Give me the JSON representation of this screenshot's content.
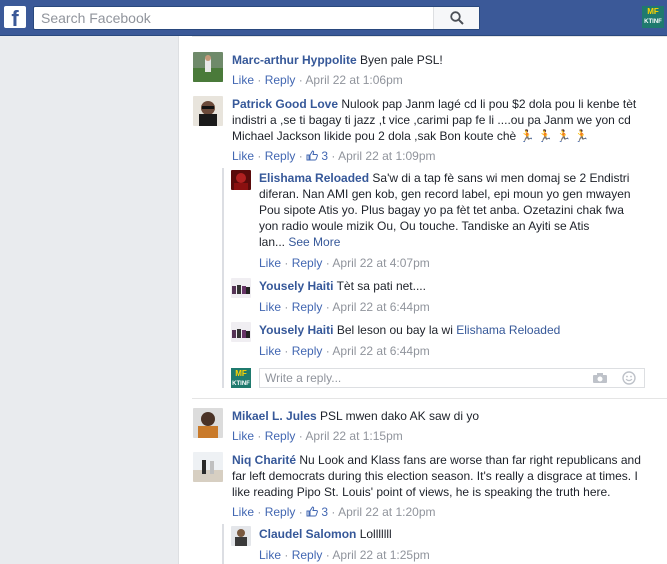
{
  "header": {
    "search_placeholder": "Search Facebook",
    "logo_letter": "f",
    "page_logo_top": "MF",
    "page_logo_bottom": "KTINF"
  },
  "comments": [
    {
      "name": "Marc-arthur Hyppolite",
      "text": "Byen pale PSL!",
      "like": "Like",
      "reply": "Reply",
      "time": "April 22 at 1:06pm"
    },
    {
      "name": "Patrick Good Love",
      "text1": "Nulook pap Janm lagé cd li pou $2 dola pou li kenbe tèt",
      "text2": "indistri a ,se ti bagay ti jazz ,t vice ,carimi pap fe li ....ou pa Janm we yon cd",
      "text3": "Michael Jackson likide pou 2 dola ,sak Bon koute chè",
      "emoji": "🏃 🏃 🏃 🏃",
      "like": "Like",
      "reply": "Reply",
      "likes": "3",
      "time": "April 22 at 1:09pm"
    },
    {
      "name": "Elishama Reloaded",
      "text1": "Sa'w di a tap fè sans wi men domaj se 2 Endistri",
      "text2": "diferan. Nan AMI gen kob, gen record label, epi moun yo gen mwayen",
      "text3": "Pou sipote Atis yo. Plus bagay yo pa fèt tet anba. Ozetazini chak fwa",
      "text4": "yon radio woule mizik Ou, Ou touche. Tandiske an Ayiti se Atis",
      "text5": "lan...",
      "see_more": "See More",
      "like": "Like",
      "reply": "Reply",
      "time": "April 22 at 4:07pm"
    },
    {
      "name": "Yousely Haiti",
      "text": "Tèt sa pati net....",
      "like": "Like",
      "reply": "Reply",
      "time": "April 22 at 6:44pm"
    },
    {
      "name": "Yousely Haiti",
      "text": "Bel leson ou bay la wi",
      "mention": "Elishama Reloaded",
      "like": "Like",
      "reply": "Reply",
      "time": "April 22 at 6:44pm"
    },
    {
      "name": "Mikael L. Jules",
      "text": "PSL mwen dako AK saw di yo",
      "like": "Like",
      "reply": "Reply",
      "time": "April 22 at 1:15pm"
    },
    {
      "name": "Niq Charité",
      "text1": "Nu Look and Klass fans are worse than far right republicans and",
      "text2": "far left democrats during this election season. It's really a disgrace at times. I",
      "text3": "like reading Pipo St. Louis' point of views, he is speaking the truth here.",
      "like": "Like",
      "reply": "Reply",
      "likes": "3",
      "time": "April 22 at 1:20pm"
    },
    {
      "name": "Claudel Salomon",
      "text": "Lolllllll",
      "like": "Like",
      "reply": "Reply",
      "time": "April 22 at 1:25pm"
    }
  ],
  "reply_box": {
    "placeholder": "Write a reply..."
  },
  "sep": " · "
}
